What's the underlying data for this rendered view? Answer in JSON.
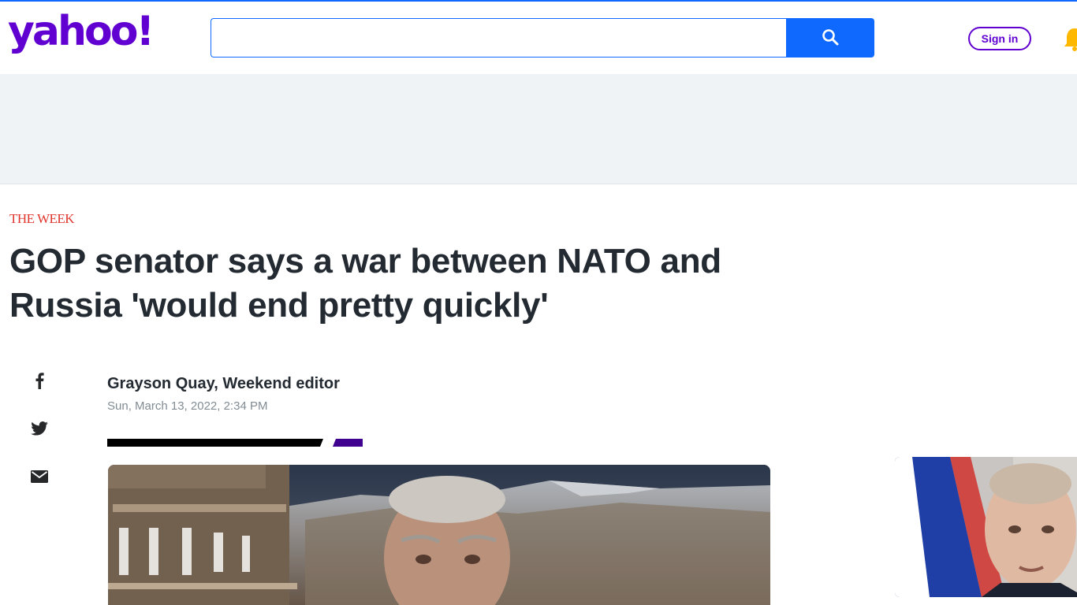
{
  "brand": {
    "logo_text": "yahoo!",
    "logo_color": "#6001d2",
    "accent_color": "#0f69ff"
  },
  "header": {
    "search": {
      "placeholder": "",
      "value": "",
      "button_icon": "search-icon"
    },
    "sign_in_label": "Sign in",
    "notification_icon": "bell-icon"
  },
  "article": {
    "source": "THE WEEK",
    "source_color": "#e0362f",
    "headline": "GOP senator says a war between NATO and Russia 'would end pretty quickly'",
    "author": "Grayson Quay, Weekend editor",
    "date": "Sun, March 13, 2022, 2:34 PM",
    "share_icons": [
      "facebook-icon",
      "twitter-icon",
      "email-icon"
    ]
  },
  "media": {
    "hero_image": "senator-capitol-mountains-photo",
    "side_image": "russian-flag-putin-photo"
  }
}
